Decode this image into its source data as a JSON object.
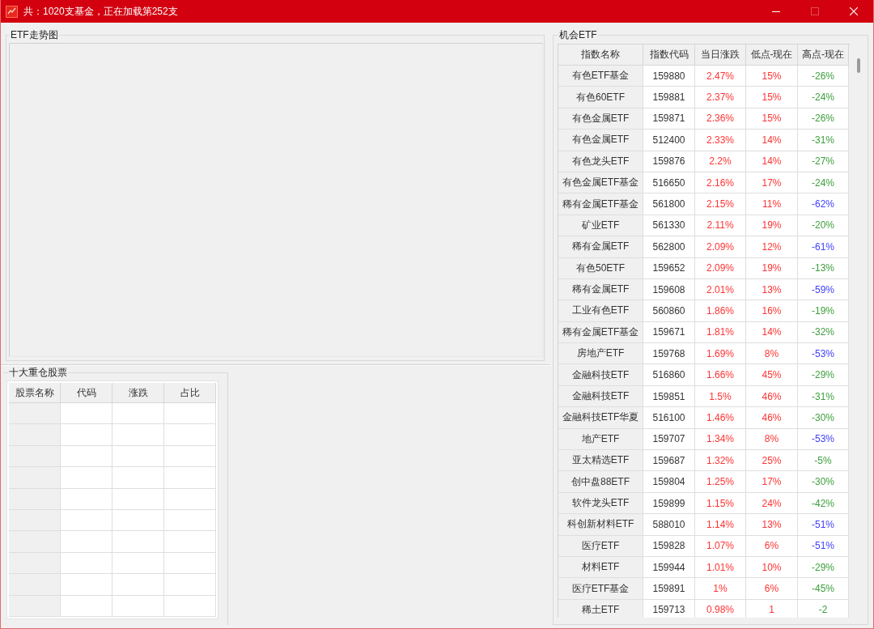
{
  "window": {
    "title": "共：1020支基金，正在加载第252支",
    "maximize_disabled": true
  },
  "trend_chart": {
    "title": "ETF走势图"
  },
  "top_holdings": {
    "title": "十大重仓股票",
    "columns": [
      "股票名称",
      "代码",
      "涨跌",
      "占比"
    ]
  },
  "opportunity_etf": {
    "title": "机会ETF",
    "columns": [
      "指数名称",
      "指数代码",
      "当日涨跌",
      "低点-现在",
      "高点-现在"
    ],
    "rows": [
      {
        "name": "有色ETF基金",
        "code": "159880",
        "change": "2.47%",
        "low": "15%",
        "high": {
          "text": "-26%",
          "color": "#3c9e3c"
        }
      },
      {
        "name": "有色60ETF",
        "code": "159881",
        "change": "2.37%",
        "low": "15%",
        "high": {
          "text": "-24%",
          "color": "#3c9e3c"
        }
      },
      {
        "name": "有色金属ETF",
        "code": "159871",
        "change": "2.36%",
        "low": "15%",
        "high": {
          "text": "-26%",
          "color": "#3c9e3c"
        }
      },
      {
        "name": "有色金属ETF",
        "code": "512400",
        "change": "2.33%",
        "low": "14%",
        "high": {
          "text": "-31%",
          "color": "#3c9e3c"
        }
      },
      {
        "name": "有色龙头ETF",
        "code": "159876",
        "change": "2.2%",
        "low": "14%",
        "high": {
          "text": "-27%",
          "color": "#3c9e3c"
        }
      },
      {
        "name": "有色金属ETF基金",
        "code": "516650",
        "change": "2.16%",
        "low": "17%",
        "high": {
          "text": "-24%",
          "color": "#3c9e3c"
        }
      },
      {
        "name": "稀有金属ETF基金",
        "code": "561800",
        "change": "2.15%",
        "low": "11%",
        "high": {
          "text": "-62%",
          "color": "#4040ff"
        }
      },
      {
        "name": "矿业ETF",
        "code": "561330",
        "change": "2.11%",
        "low": "19%",
        "high": {
          "text": "-20%",
          "color": "#3c9e3c"
        }
      },
      {
        "name": "稀有金属ETF",
        "code": "562800",
        "change": "2.09%",
        "low": "12%",
        "high": {
          "text": "-61%",
          "color": "#4040ff"
        }
      },
      {
        "name": "有色50ETF",
        "code": "159652",
        "change": "2.09%",
        "low": "19%",
        "high": {
          "text": "-13%",
          "color": "#3c9e3c"
        }
      },
      {
        "name": "稀有金属ETF",
        "code": "159608",
        "change": "2.01%",
        "low": "13%",
        "high": {
          "text": "-59%",
          "color": "#4040ff"
        }
      },
      {
        "name": "工业有色ETF",
        "code": "560860",
        "change": "1.86%",
        "low": "16%",
        "high": {
          "text": "-19%",
          "color": "#3c9e3c"
        }
      },
      {
        "name": "稀有金属ETF基金",
        "code": "159671",
        "change": "1.81%",
        "low": "14%",
        "high": {
          "text": "-32%",
          "color": "#3c9e3c"
        }
      },
      {
        "name": "房地产ETF",
        "code": "159768",
        "change": "1.69%",
        "low": "8%",
        "high": {
          "text": "-53%",
          "color": "#4040ff"
        }
      },
      {
        "name": "金融科技ETF",
        "code": "516860",
        "change": "1.66%",
        "low": "45%",
        "high": {
          "text": "-29%",
          "color": "#3c9e3c"
        }
      },
      {
        "name": "金融科技ETF",
        "code": "159851",
        "change": "1.5%",
        "low": "46%",
        "high": {
          "text": "-31%",
          "color": "#3c9e3c"
        }
      },
      {
        "name": "金融科技ETF华夏",
        "code": "516100",
        "change": "1.46%",
        "low": "46%",
        "high": {
          "text": "-30%",
          "color": "#3c9e3c"
        }
      },
      {
        "name": "地产ETF",
        "code": "159707",
        "change": "1.34%",
        "low": "8%",
        "high": {
          "text": "-53%",
          "color": "#4040ff"
        }
      },
      {
        "name": "亚太精选ETF",
        "code": "159687",
        "change": "1.32%",
        "low": "25%",
        "high": {
          "text": "-5%",
          "color": "#3c9e3c"
        }
      },
      {
        "name": "创中盘88ETF",
        "code": "159804",
        "change": "1.25%",
        "low": "17%",
        "high": {
          "text": "-30%",
          "color": "#3c9e3c"
        }
      },
      {
        "name": "软件龙头ETF",
        "code": "159899",
        "change": "1.15%",
        "low": "24%",
        "high": {
          "text": "-42%",
          "color": "#3c9e3c"
        }
      },
      {
        "name": "科创新材料ETF",
        "code": "588010",
        "change": "1.14%",
        "low": "13%",
        "high": {
          "text": "-51%",
          "color": "#4040ff"
        }
      },
      {
        "name": "医疗ETF",
        "code": "159828",
        "change": "1.07%",
        "low": "6%",
        "high": {
          "text": "-51%",
          "color": "#4040ff"
        }
      },
      {
        "name": "材料ETF",
        "code": "159944",
        "change": "1.01%",
        "low": "10%",
        "high": {
          "text": "-29%",
          "color": "#3c9e3c"
        }
      },
      {
        "name": "医疗ETF基金",
        "code": "159891",
        "change": "1%",
        "low": "6%",
        "high": {
          "text": "-45%",
          "color": "#3c9e3c"
        }
      },
      {
        "name": "稀土ETF",
        "code": "159713",
        "change": "0.98%",
        "low": "1",
        "high": {
          "text": "-2",
          "color": "#3c9e3c"
        }
      }
    ]
  }
}
